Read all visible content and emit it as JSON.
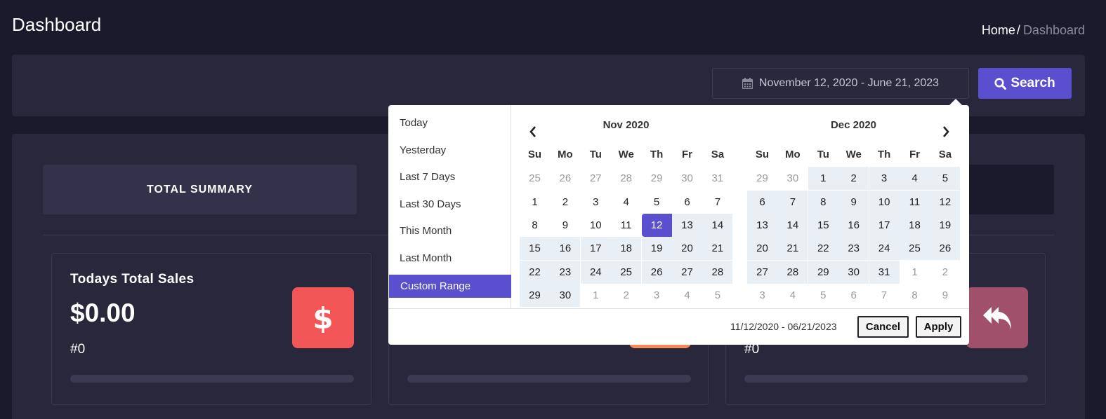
{
  "header": {
    "title": "Dashboard",
    "breadcrumb_home": "Home",
    "breadcrumb_sep": "/",
    "breadcrumb_current": "Dashboard"
  },
  "filter": {
    "date_range_display": "November 12, 2020 - June 21, 2023",
    "search_label": "Search",
    "calendar_icon": "calendar-icon",
    "search_icon": "search-icon"
  },
  "tabs": {
    "active_label": "TOTAL SUMMARY"
  },
  "stats": [
    {
      "title": "Todays Total Sales",
      "value": "$0.00",
      "count": "#0",
      "icon": "dollar-icon",
      "color": "#f35656"
    },
    {
      "title": "",
      "value": "",
      "count": "",
      "icon": "",
      "color": "#f58a5b"
    },
    {
      "title": "",
      "value": "",
      "count": "#0",
      "icon": "reply-all-icon",
      "color": "#a0506a"
    }
  ],
  "picker": {
    "ranges": [
      "Today",
      "Yesterday",
      "Last 7 Days",
      "Last 30 Days",
      "This Month",
      "Last Month",
      "Custom Range"
    ],
    "active_range": "Custom Range",
    "weekdays": [
      "Su",
      "Mo",
      "Tu",
      "We",
      "Th",
      "Fr",
      "Sa"
    ],
    "left_month": "Nov 2020",
    "right_month": "Dec 2020",
    "left_days": [
      [
        "25",
        "26",
        "27",
        "28",
        "29",
        "30",
        "31"
      ],
      [
        "1",
        "2",
        "3",
        "4",
        "5",
        "6",
        "7"
      ],
      [
        "8",
        "9",
        "10",
        "11",
        "12",
        "13",
        "14"
      ],
      [
        "15",
        "16",
        "17",
        "18",
        "19",
        "20",
        "21"
      ],
      [
        "22",
        "23",
        "24",
        "25",
        "26",
        "27",
        "28"
      ],
      [
        "29",
        "30",
        "1",
        "2",
        "3",
        "4",
        "5"
      ]
    ],
    "right_days": [
      [
        "29",
        "30",
        "1",
        "2",
        "3",
        "4",
        "5"
      ],
      [
        "6",
        "7",
        "8",
        "9",
        "10",
        "11",
        "12"
      ],
      [
        "13",
        "14",
        "15",
        "16",
        "17",
        "18",
        "19"
      ],
      [
        "20",
        "21",
        "22",
        "23",
        "24",
        "25",
        "26"
      ],
      [
        "27",
        "28",
        "29",
        "30",
        "31",
        "1",
        "2"
      ],
      [
        "3",
        "4",
        "5",
        "6",
        "7",
        "8",
        "9"
      ]
    ],
    "start_date": "11/12/2020",
    "selected_text": "11/12/2020 - 06/21/2023",
    "cancel_label": "Cancel",
    "apply_label": "Apply",
    "accent": "#5a4fcf",
    "in_range_color": "#e8f0f6"
  }
}
